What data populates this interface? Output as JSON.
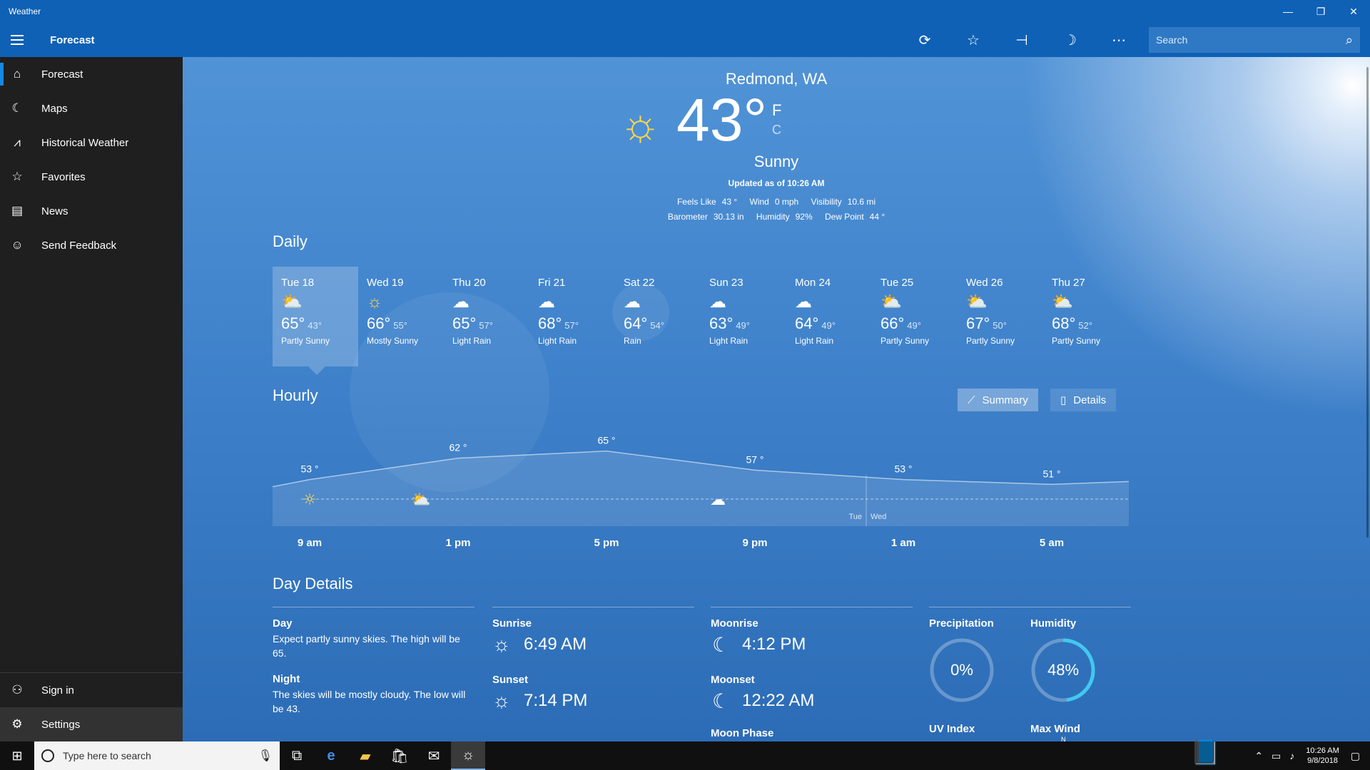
{
  "window": {
    "title": "Weather",
    "minimize": "—",
    "restore": "❐",
    "close": "✕"
  },
  "command_bar": {
    "page_title": "Forecast",
    "icons": [
      "refresh-icon",
      "favorite-star-icon",
      "pin-icon",
      "moon-icon",
      "more-icon"
    ],
    "search_placeholder": "Search"
  },
  "sidebar": {
    "items": [
      {
        "label": "Forecast",
        "icon": "home-icon",
        "active": true
      },
      {
        "label": "Maps",
        "icon": "maps-icon"
      },
      {
        "label": "Historical Weather",
        "icon": "chart-icon"
      },
      {
        "label": "Favorites",
        "icon": "star-list-icon"
      },
      {
        "label": "News",
        "icon": "news-icon"
      },
      {
        "label": "Send Feedback",
        "icon": "smiley-icon"
      }
    ],
    "bottom": [
      {
        "label": "Sign in",
        "icon": "person-icon"
      },
      {
        "label": "Settings",
        "icon": "gear-icon"
      }
    ]
  },
  "current": {
    "location": "Redmond, WA",
    "temperature": "43°",
    "unit_f": "F",
    "unit_c": "C",
    "condition": "Sunny",
    "updated": "Updated as of 10:26 AM",
    "row1": [
      {
        "label": "Feels Like",
        "value": "43 °"
      },
      {
        "label": "Wind",
        "value": "0 mph"
      },
      {
        "label": "Visibility",
        "value": "10.6 mi"
      }
    ],
    "row2": [
      {
        "label": "Barometer",
        "value": "30.13 in"
      },
      {
        "label": "Humidity",
        "value": "92%"
      },
      {
        "label": "Dew Point",
        "value": "44 °"
      }
    ]
  },
  "daily": {
    "title": "Daily",
    "days": [
      {
        "name": "Tue 18",
        "icon": "partly-sunny",
        "hi": "65°",
        "lo": "43°",
        "cond": "Partly Sunny",
        "selected": true
      },
      {
        "name": "Wed 19",
        "icon": "sunny",
        "hi": "66°",
        "lo": "55°",
        "cond": "Mostly Sunny"
      },
      {
        "name": "Thu 20",
        "icon": "rain",
        "hi": "65°",
        "lo": "57°",
        "cond": "Light Rain"
      },
      {
        "name": "Fri 21",
        "icon": "rain",
        "hi": "68°",
        "lo": "57°",
        "cond": "Light Rain"
      },
      {
        "name": "Sat 22",
        "icon": "rain",
        "hi": "64°",
        "lo": "54°",
        "cond": "Rain"
      },
      {
        "name": "Sun 23",
        "icon": "rain",
        "hi": "63°",
        "lo": "49°",
        "cond": "Light Rain"
      },
      {
        "name": "Mon 24",
        "icon": "rain",
        "hi": "64°",
        "lo": "49°",
        "cond": "Light Rain"
      },
      {
        "name": "Tue 25",
        "icon": "partly-sunny",
        "hi": "66°",
        "lo": "49°",
        "cond": "Partly Sunny"
      },
      {
        "name": "Wed 26",
        "icon": "partly-sunny",
        "hi": "67°",
        "lo": "50°",
        "cond": "Partly Sunny"
      },
      {
        "name": "Thu 27",
        "icon": "partly-sunny",
        "hi": "68°",
        "lo": "52°",
        "cond": "Partly Sunny"
      }
    ]
  },
  "hourly": {
    "title": "Hourly",
    "summary_label": "Summary",
    "details_label": "Details",
    "temp_labels": [
      "53 °",
      "62 °",
      "65 °",
      "57 °",
      "53 °",
      "51 °"
    ],
    "time_labels": [
      "9 am",
      "1 pm",
      "5 pm",
      "9 pm",
      "1 am",
      "5 am"
    ],
    "day_split": {
      "left": "Tue",
      "right": "Wed"
    },
    "hours": [
      {
        "hour": "9 am",
        "temp": 53
      },
      {
        "hour": "1 pm",
        "temp": 62
      },
      {
        "hour": "5 pm",
        "temp": 65
      },
      {
        "hour": "9 pm",
        "temp": 57
      },
      {
        "hour": "1 am",
        "temp": 53
      },
      {
        "hour": "5 am",
        "temp": 51
      }
    ],
    "condition_icons": [
      {
        "hour": "9 am",
        "icon": "sunny"
      },
      {
        "hour": "12 pm",
        "icon": "partly-sunny"
      },
      {
        "hour": "8 pm",
        "icon": "partly-cloudy-night"
      }
    ]
  },
  "day_details": {
    "title": "Day Details",
    "day_label": "Day",
    "day_text": "Expect partly sunny skies. The high will be 65.",
    "night_label": "Night",
    "night_text": "The skies will be mostly cloudy. The low will be 43.",
    "sunrise_label": "Sunrise",
    "sunrise": "6:49 AM",
    "sunset_label": "Sunset",
    "sunset": "7:14 PM",
    "moonrise_label": "Moonrise",
    "moonrise": "4:12 PM",
    "moonset_label": "Moonset",
    "moonset": "12:22 AM",
    "moon_phase_label": "Moon Phase",
    "precip_label": "Precipitation",
    "precip": "0%",
    "precip_fraction": 0,
    "humidity_label": "Humidity",
    "humidity": "48%",
    "humidity_fraction": 0.48,
    "uv_label": "UV Index",
    "max_wind_label": "Max Wind",
    "max_wind_compass": "N"
  },
  "taskbar": {
    "search_placeholder": "Type here to search",
    "apps": [
      "task-view-icon",
      "edge-icon",
      "file-explorer-icon",
      "store-icon",
      "mail-icon",
      "weather-icon"
    ],
    "clock_time": "10:26 AM",
    "clock_date": "9/8/2018"
  },
  "colors": {
    "title_bar": "#0f61b5",
    "sidebar": "#1f1f1f",
    "accent": "#1688e5",
    "humidity_ring": "#41c8f0",
    "sun": "#ffd54a"
  }
}
